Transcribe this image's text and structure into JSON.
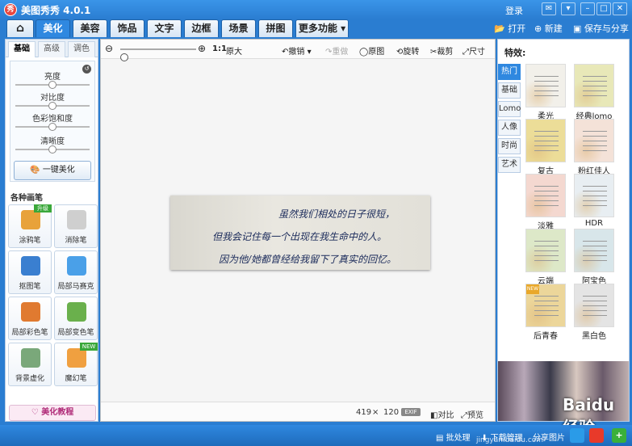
{
  "app": {
    "logo": "秀",
    "title": "美图秀秀 4.0.1",
    "login": "登录"
  },
  "top_actions": {
    "open": "打开",
    "new": "新建",
    "save_share": "保存与分享"
  },
  "tabs": [
    "美化",
    "美容",
    "饰品",
    "文字",
    "边框",
    "场景",
    "拼图",
    "更多功能"
  ],
  "active_tab": "美化",
  "left": {
    "subtabs": [
      "基础",
      "高级",
      "调色"
    ],
    "sliders": [
      {
        "label": "亮度",
        "level": 0.5
      },
      {
        "label": "对比度",
        "level": 0.5
      },
      {
        "label": "色彩饱和度",
        "level": 0.5
      },
      {
        "label": "清晰度",
        "level": 0.5
      }
    ],
    "one_key": "一键美化",
    "brush_title": "各种画笔",
    "brushes": [
      {
        "label": "涂鸦笔",
        "badge": "升级",
        "color": "#e8a23a"
      },
      {
        "label": "消除笔",
        "badge": "",
        "color": "#cfcfcf"
      },
      {
        "label": "抠图笔",
        "badge": "",
        "color": "#3a7fd0"
      },
      {
        "label": "局部马赛克",
        "badge": "",
        "color": "#4aa0e8"
      },
      {
        "label": "局部彩色笔",
        "badge": "",
        "color": "#e07a30"
      },
      {
        "label": "局部变色笔",
        "badge": "",
        "color": "#6ab04c"
      },
      {
        "label": "背景虚化",
        "badge": "",
        "color": "#7aa87a"
      },
      {
        "label": "魔幻笔",
        "badge": "NEW",
        "color": "#f0a040"
      }
    ],
    "tutorial": "美化教程"
  },
  "toolbar": {
    "ratio": "1:1",
    "original_size": "原大",
    "undo": "撤销",
    "redo": "重做",
    "original": "原图",
    "rotate": "旋转",
    "crop": "裁剪",
    "size": "尺寸",
    "zoom_level": 0.05
  },
  "photo_lines": [
    "虽然我们相处的日子很短，",
    "但我会记住每一个出现在我生命中的人。",
    "因为他/她都曾经给我留下了真实的回忆。"
  ],
  "status": {
    "width": "419",
    "times": "×",
    "height": "120",
    "exif": "EXIF",
    "compare": "对比",
    "preview": "预览"
  },
  "effects": {
    "title": "特效:",
    "categories": [
      "热门",
      "基础",
      "Lomo",
      "人像",
      "时尚",
      "艺术"
    ],
    "active_category": "热门",
    "items": [
      {
        "label": "柔光",
        "tint": "#f2f0ea",
        "badge": ""
      },
      {
        "label": "经典lomo",
        "tint": "#e8e8b8",
        "badge": ""
      },
      {
        "label": "复古",
        "tint": "#ecdd98",
        "badge": ""
      },
      {
        "label": "粉红佳人",
        "tint": "#f4e2d8",
        "badge": ""
      },
      {
        "label": "淡雅",
        "tint": "#f4d8d0",
        "badge": ""
      },
      {
        "label": "HDR",
        "tint": "#e8eef2",
        "badge": ""
      },
      {
        "label": "云端",
        "tint": "#dde8c8",
        "badge": ""
      },
      {
        "label": "阿宝色",
        "tint": "#d8e6ea",
        "badge": ""
      },
      {
        "label": "后青春",
        "tint": "#ecd69a",
        "badge": "NEW"
      },
      {
        "label": "黑白色",
        "tint": "#e4e4e4",
        "badge": ""
      }
    ]
  },
  "watermark": "Baidu 经验",
  "bottom": {
    "batch": "批处理",
    "download": "下载管理",
    "share": "分享图片",
    "url": "jingyan.baidu.com"
  }
}
